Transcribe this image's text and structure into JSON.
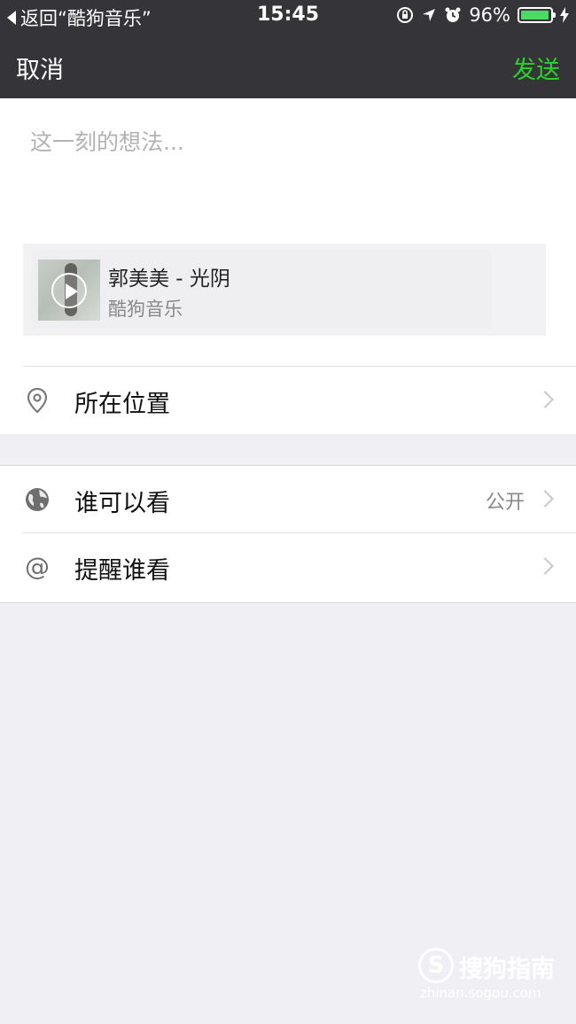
{
  "status_bar": {
    "back_app": "返回“酷狗音乐”",
    "time": "15:45",
    "battery_percent": "96%",
    "battery_level": 0.96,
    "battery_color": "#4cd964"
  },
  "nav": {
    "cancel_label": "取消",
    "send_label": "发送",
    "send_color": "#2bd12b"
  },
  "compose": {
    "placeholder": "这一刻的想法..."
  },
  "music": {
    "title": "郭美美 - 光阴",
    "source": "酷狗音乐"
  },
  "options": {
    "location_label": "所在位置",
    "visibility_label": "谁可以看",
    "visibility_value": "公开",
    "mention_label": "提醒谁看"
  },
  "icons": {
    "location": "location-pin-icon",
    "visibility": "globe-icon",
    "mention": "at-icon"
  },
  "watermark": {
    "logo_letter": "S",
    "brand": "搜狗指南",
    "url": "zhinan.sogou.com"
  }
}
